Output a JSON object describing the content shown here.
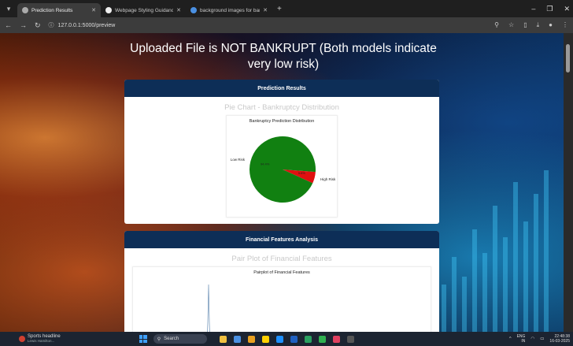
{
  "browser": {
    "tabs": [
      {
        "title": "Prediction Results",
        "active": true
      },
      {
        "title": "Webpage Styling Guidance",
        "active": false
      },
      {
        "title": "background images for bankru",
        "active": false
      }
    ],
    "url": "127.0.0.1:5000/preview"
  },
  "page": {
    "headline": "Uploaded File is NOT BANKRUPT (Both models indicate very low risk)",
    "prediction_card": {
      "header": "Prediction Results",
      "section_title": "Pie Chart - Bankruptcy Distribution"
    },
    "features_card": {
      "header": "Financial Features Analysis",
      "section_title": "Pair Plot of Financial Features"
    }
  },
  "chart_data": [
    {
      "type": "pie",
      "title": "Bankruptcy Prediction Distribution",
      "labels": [
        "Low Risk",
        "High Risk"
      ],
      "values": [
        94.4,
        5.6
      ],
      "value_labels": [
        "94.4%",
        "5.6%"
      ],
      "colors": [
        "#118011",
        "#e01010"
      ]
    },
    {
      "type": "line",
      "title": "Pairplot of Financial Features"
    }
  ],
  "taskbar": {
    "weather_title": "Sports headline",
    "weather_sub": "Lewis Hamilton...",
    "search_placeholder": "Search",
    "lang": "ENG",
    "region": "IN",
    "time": "22:48:38",
    "date": "16-03-2025"
  }
}
